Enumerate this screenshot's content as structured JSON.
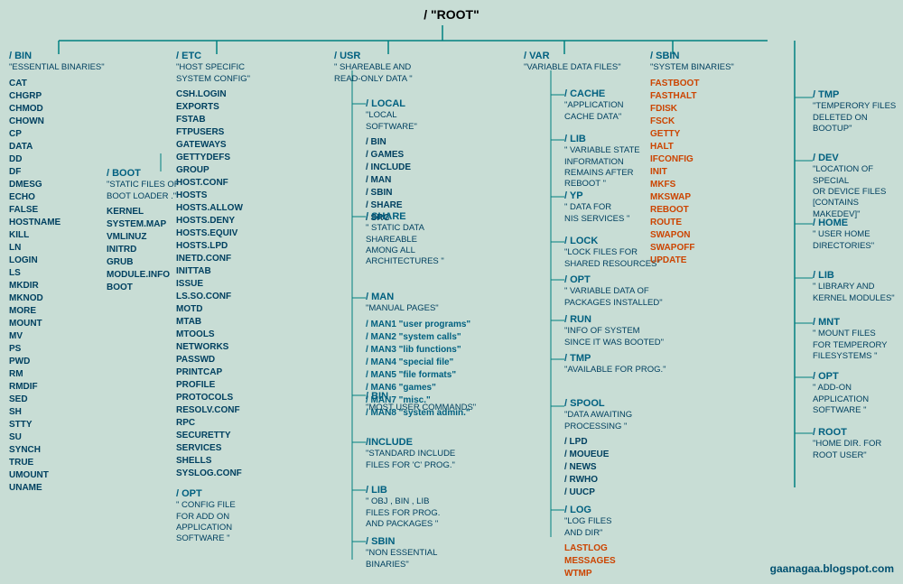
{
  "title": "/   \"ROOT\"",
  "nodes": {
    "root": {
      "label": "/   \"ROOT\""
    },
    "bin": {
      "label": "/ BIN",
      "desc": "\"ESSENTIAL BINARIES\"",
      "files": [
        "CAT",
        "CHGRP",
        "CHMOD",
        "CHOWN",
        "CP",
        "DATA",
        "DD",
        "DF",
        "DMESG",
        "ECHO",
        "FALSE",
        "HOSTNAME",
        "KILL",
        "LN",
        "LOGIN",
        "LS",
        "MKDIR",
        "MKNOD",
        "MORE",
        "MOUNT",
        "MV",
        "PS",
        "PWD",
        "RM",
        "RMDIF",
        "SED",
        "SH",
        "STTY",
        "SU",
        "SYNCH",
        "TRUE",
        "UMOUNT",
        "UNAME"
      ]
    },
    "etc": {
      "label": "/ ETC",
      "desc": "\"HOST SPECIFIC SYSTEM CONFIG\"",
      "files": [
        "CSH.LOGIN",
        "EXPORTS",
        "FSTAB",
        "FTPUSERS",
        "GATEWAYS",
        "GETTYDEFS",
        "GROUP",
        "HOST.CONF",
        "HOSTS",
        "HOSTS.ALLOW",
        "HOSTS.DENY",
        "HOSTS.EQUIV",
        "HOSTS.LPD",
        "INETD.CONF",
        "INITTAB",
        "ISSUE",
        "LS.SO.CONF",
        "MOTD",
        "MTAB",
        "MTOOLS",
        "NETWORKS",
        "PASSWD",
        "PRINTCAP",
        "PROFILE",
        "PROTOCOLS",
        "RESOLV.CONF",
        "RPC",
        "SECURETTY",
        "SERVICES",
        "SHELLS",
        "SYSLOG.CONF"
      ],
      "opt": {
        "label": "/ OPT",
        "desc": "\" CONFIG FILE FOR ADD ON APPLICATION SOFTWARE \""
      }
    },
    "boot": {
      "label": "/ BOOT",
      "desc": "\"STATIC FILES OF BOOT LOADER .\"",
      "files": [
        "KERNEL",
        "SYSTEM.MAP",
        "VMLINUZ",
        "INITRD",
        "GRUB",
        "MODULE.INFO",
        "BOOT"
      ]
    },
    "usr": {
      "label": "/ USR",
      "desc": "\" SHAREABLE AND READ-ONLY DATA \"",
      "local": {
        "label": "/ LOCAL",
        "desc": "\"LOCAL SOFTWARE\"",
        "sub": [
          "/ BIN",
          "/ GAMES",
          "/ INCLUDE",
          "/ MAN",
          "/ SBIN",
          "/ SHARE",
          "/ SRC"
        ]
      },
      "share": {
        "label": "/ SHARE",
        "desc": "\" STATIC DATA SHAREABLE AMONG ALL ARCHITECTURES \""
      },
      "man": {
        "label": "/ MAN",
        "desc": "\"MANUAL PAGES\"",
        "sub": [
          "/ MAN1 \"user programs\"",
          "/ MAN2 \"system calls\"",
          "/ MAN3 \"lib functions\"",
          "/ MAN4 \"special file\"",
          "/ MAN5 \"file formats\"",
          "/ MAN6 \"games\"",
          "/ MAN7 \"misc.\"",
          "/ MAN8 \"system admin.\""
        ]
      },
      "bin": {
        "label": "/ BIN",
        "desc": "\"MOST USER COMMANDS\""
      },
      "include": {
        "label": "/ INCLUDE",
        "desc": "\"STANDARD INCLUDE FILES FOR 'C' PROG.\""
      },
      "lib": {
        "label": "/ LIB",
        "desc": "\" OBJ , BIN , LIB FILES FOR PROG. AND PACKAGES \""
      },
      "sbin": {
        "label": "/ SBIN",
        "desc": "\"NON ESSENTIAL BINARIES\""
      }
    },
    "var": {
      "label": "/ VAR",
      "desc": "\"VARIABLE DATA FILES\"",
      "cache": {
        "label": "/ CACHE",
        "desc": "\"APPLICATION CACHE DATA\""
      },
      "lib": {
        "label": "/ LIB",
        "desc": "\" VARIABLE STATE INFORMATION REMAINS AFTER REBOOT \""
      },
      "yp": {
        "label": "/ YP",
        "desc": "\" DATA FOR NIS SERVICES \""
      },
      "lock": {
        "label": "/ LOCK",
        "desc": "\"LOCK FILES FOR SHARED RESOURCES\""
      },
      "opt": {
        "label": "/ OPT",
        "desc": "\" VARIABLE DATA OF PACKAGES INSTALLED\""
      },
      "run": {
        "label": "/ RUN",
        "desc": "\"INFO OF SYSTEM SINCE IT WAS BOOTED\""
      },
      "tmp": {
        "label": "/ TMP",
        "desc": "\"AVAILABLE FOR PROG.\""
      },
      "spool": {
        "label": "/ SPOOL",
        "desc": "\"DATA AWAITING PROCESSING \"",
        "sub": [
          "/ LPD",
          "/ MOUEUE",
          "/ NEWS",
          "/ RWHO",
          "/ UUCP"
        ]
      },
      "log": {
        "label": "/ LOG",
        "desc": "\"LOG FILES AND DIR\"",
        "files_orange": [
          "LASTLOG",
          "MESSAGES",
          "WTMP"
        ]
      }
    },
    "sbin": {
      "label": "/ SBIN",
      "desc": "\"SYSTEM BINARIES\"",
      "files_orange": [
        "FASTBOOT",
        "FASTHALT",
        "FDISK",
        "FSCK",
        "GETTY",
        "HALT",
        "IFCONFIG",
        "INIT",
        "MKFS",
        "MKSWAP",
        "REBOOT",
        "ROUTE",
        "SWAPON",
        "SWAPOFF",
        "UPDATE"
      ]
    },
    "tmp": {
      "label": "/ TMP",
      "desc": "\"TEMPERORY FILES DELETED ON BOOTUP\""
    },
    "dev": {
      "label": "/ DEV",
      "desc": "\"LOCATION OF SPECIAL OR DEVICE FILES [CONTAINS MAKEDEV]\""
    },
    "home": {
      "label": "/ HOME",
      "desc": "\" USER HOME DIRECTORIES\""
    },
    "lib": {
      "label": "/ LIB",
      "desc": "\"  LIBRARY AND KERNEL MODULES\""
    },
    "mnt": {
      "label": "/ MNT",
      "desc": "\"  MOUNT FILES FOR TEMPERORY FILESYSTEMS \""
    },
    "opt": {
      "label": "/ OPT",
      "desc": "\" ADD-ON APPLICATION SOFTWARE \""
    },
    "root_home": {
      "label": "/ ROOT",
      "desc": "\"HOME DIR. FOR ROOT USER\""
    }
  },
  "watermark": "gaanagaa.blogspot.com"
}
